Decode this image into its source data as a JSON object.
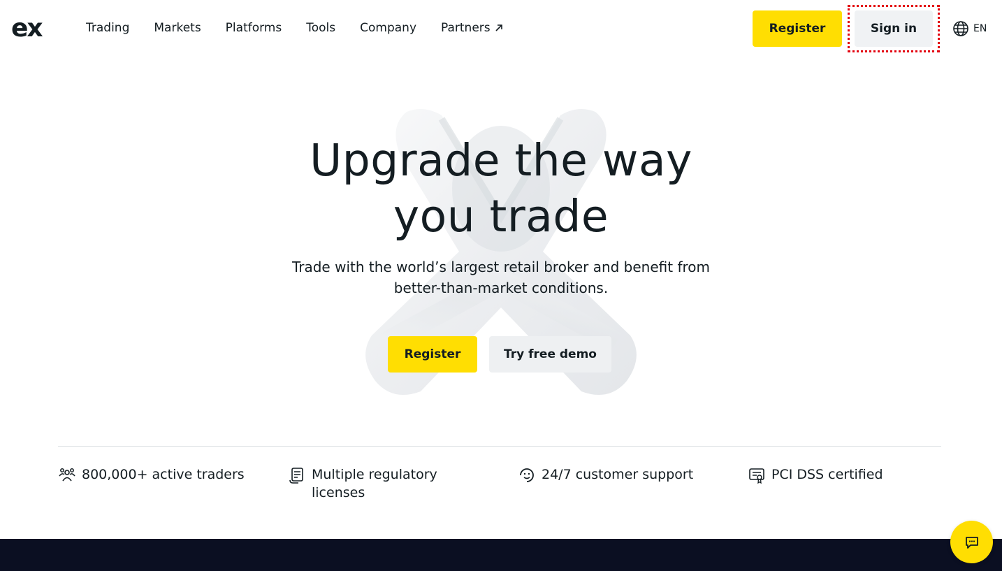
{
  "header": {
    "logo_text": "ex",
    "nav": [
      {
        "label": "Trading"
      },
      {
        "label": "Markets"
      },
      {
        "label": "Platforms"
      },
      {
        "label": "Tools"
      },
      {
        "label": "Company"
      },
      {
        "label": "Partners"
      }
    ],
    "register_label": "Register",
    "signin_label": "Sign in",
    "language": "EN"
  },
  "hero": {
    "title_line1": "Upgrade the way",
    "title_line2": "you trade",
    "subtitle_line1": "Trade with the world’s largest retail broker and benefit from",
    "subtitle_line2": "better-than-market conditions.",
    "register_label": "Register",
    "demo_label": "Try free demo"
  },
  "features": [
    {
      "icon": "users-icon",
      "line1": "800,000+ active traders",
      "line2": ""
    },
    {
      "icon": "license-icon",
      "line1": "Multiple regulatory",
      "line2": "licenses"
    },
    {
      "icon": "support-icon",
      "line1": "24/7 customer support",
      "line2": ""
    },
    {
      "icon": "certificate-icon",
      "line1": "PCI DSS certified",
      "line2": ""
    }
  ],
  "colors": {
    "accent": "#ffde02",
    "text": "#141d22",
    "dark_band": "#0b0f22",
    "highlight_outline": "#e3000f"
  }
}
